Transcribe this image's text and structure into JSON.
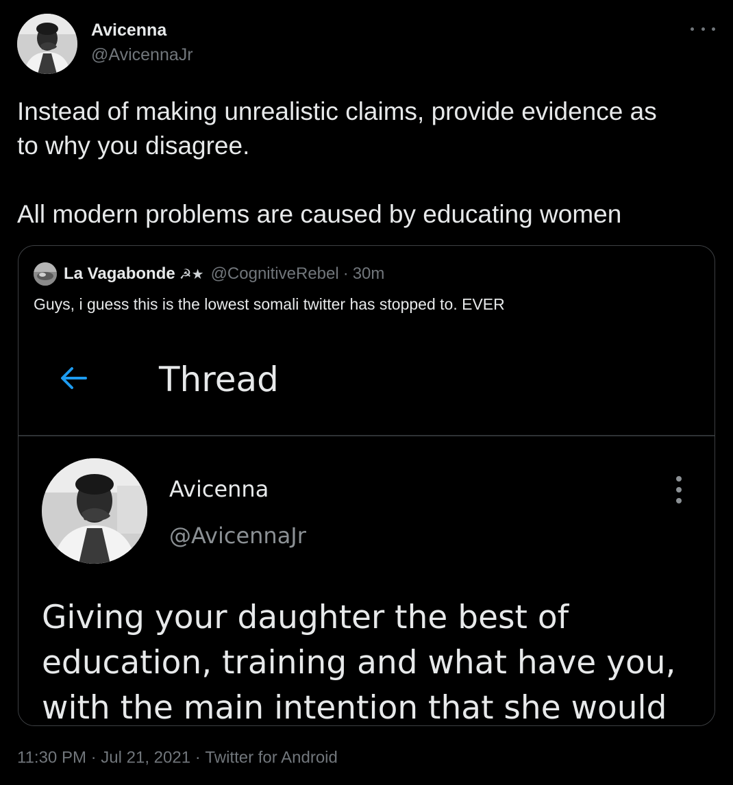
{
  "tweet": {
    "display_name": "Avicenna",
    "handle": "@AvicennaJr",
    "text_lines": [
      "Instead of making unrealistic claims, provide evidence as",
      "to why you disagree.",
      "",
      "All modern problems are caused by educating women"
    ],
    "timestamp": "11:30 PM",
    "date": "Jul 21, 2021",
    "source": "Twitter for Android",
    "separator": "·",
    "more_icon": "more-horizontal-icon"
  },
  "quoted_tweet": {
    "display_name": "La Vagabonde",
    "name_emoji": "☭★",
    "handle": "@CognitiveRebel",
    "separator": "·",
    "time_ago": "30m",
    "text": "Guys, i guess this is the lowest somali twitter has stopped to. EVER",
    "screenshot": {
      "back_icon": "arrow-left-icon",
      "title": "Thread",
      "author_name": "Avicenna",
      "author_handle": "@AvicennaJr",
      "menu_icon": "more-vertical-icon",
      "text_lines": [
        "Giving your daughter the best of",
        "education, training and what have you,",
        "with the main intention that she would"
      ]
    }
  },
  "colors": {
    "background": "#000000",
    "text_primary": "#e7e9ea",
    "text_secondary": "#71767b",
    "border": "#3e4144",
    "accent": "#1d9bf0"
  }
}
